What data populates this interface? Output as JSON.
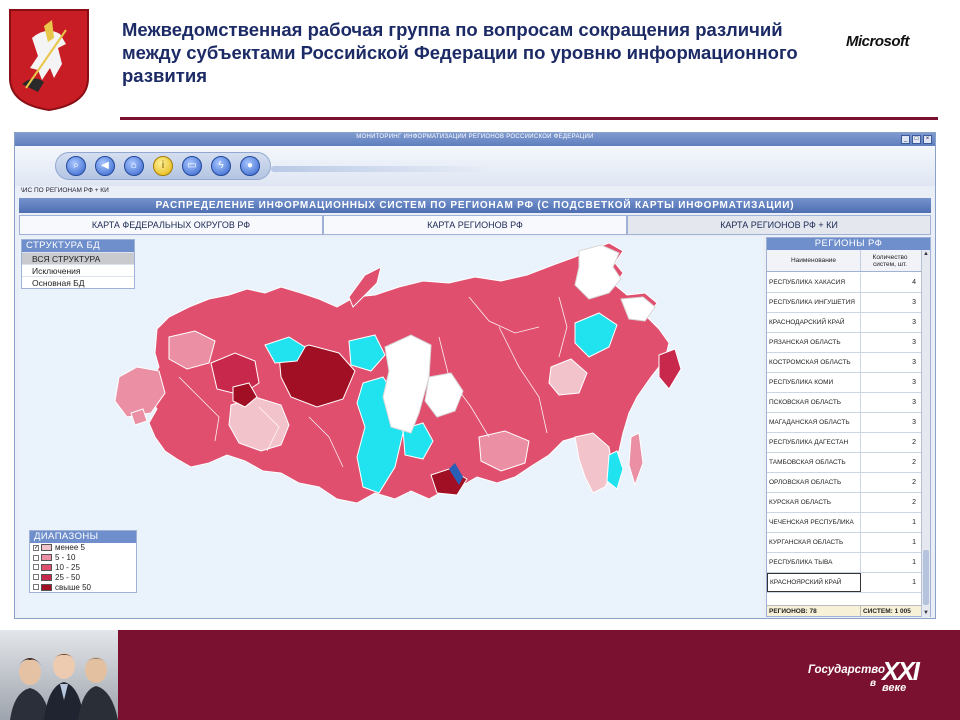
{
  "slide": {
    "title": "Межведомственная рабочая группа по вопросам сокращения различий между субъектами Российской Федерации по уровню информационного развития",
    "logo_text": "Microsoft",
    "footer_logo": {
      "word": "Государство",
      "numeral": "XXI",
      "preposition": "в",
      "suffix": "веке"
    }
  },
  "app": {
    "window_title": "МОНИТОРИНГ ИНФОРМАТИЗАЦИИ РЕГИОНОВ РОССИЙСКОЙ ФЕДЕРАЦИИ",
    "toolbar_icons": [
      "search-icon",
      "back-icon",
      "home-icon",
      "info-icon",
      "book-icon",
      "lightning-icon",
      "user-icon"
    ],
    "breadcrumb": "\\ИС ПО РЕГИОНАМ РФ + КИ",
    "section_title": "РАСПРЕДЕЛЕНИЕ ИНФОРМАЦИОННЫХ СИСТЕМ ПО РЕГИОНАМ РФ (С ПОДСВЕТКОЙ КАРТЫ ИНФОРМАТИЗАЦИИ)",
    "tabs": [
      "КАРТА ФЕДЕРАЛЬНЫХ ОКРУГОВ РФ",
      "КАРТА РЕГИОНОВ РФ",
      "КАРТА РЕГИОНОВ РФ + КИ"
    ],
    "active_tab": 2,
    "structure_panel": {
      "title": "СТРУКТУРА БД",
      "items": [
        "ВСЯ СТРУКТУРА",
        "Исключения",
        "Основная БД"
      ],
      "selected": 0
    },
    "legend_panel": {
      "title": "ДИАПАЗОНЫ",
      "items": [
        {
          "label": "менее 5",
          "color": "#f3c3cc",
          "checked": true
        },
        {
          "label": "5 - 10",
          "color": "#ea8fa4",
          "checked": false
        },
        {
          "label": "10 - 25",
          "color": "#e0506e",
          "checked": false
        },
        {
          "label": "25 - 50",
          "color": "#c8284c",
          "checked": false
        },
        {
          "label": "свыше 50",
          "color": "#a00f24",
          "checked": false
        }
      ]
    },
    "map_colors": {
      "cyan": "#21e3ef",
      "white": "#ffffff",
      "lightpink": "#f3c3cc",
      "pink": "#ea8fa4",
      "red": "#e0506e",
      "crimson": "#c8284c",
      "darkred": "#a00f24",
      "sea": "#eaf2fb"
    },
    "regions_panel": {
      "title": "РЕГИОНЫ РФ",
      "col_name": "Наименование",
      "col_count": "Количество систем, шт.",
      "rows": [
        {
          "name": "РЕСПУБЛИКА ХАКАСИЯ",
          "count": "4"
        },
        {
          "name": "РЕСПУБЛИКА ИНГУШЕТИЯ",
          "count": "3"
        },
        {
          "name": "КРАСНОДАРСКИЙ КРАЙ",
          "count": "3"
        },
        {
          "name": "РЯЗАНСКАЯ ОБЛАСТЬ",
          "count": "3"
        },
        {
          "name": "КОСТРОМСКАЯ ОБЛАСТЬ",
          "count": "3"
        },
        {
          "name": "РЕСПУБЛИКА КОМИ",
          "count": "3"
        },
        {
          "name": "ПСКОВСКАЯ ОБЛАСТЬ",
          "count": "3"
        },
        {
          "name": "МАГАДАНСКАЯ ОБЛАСТЬ",
          "count": "3"
        },
        {
          "name": "РЕСПУБЛИКА ДАГЕСТАН",
          "count": "2"
        },
        {
          "name": "ТАМБОВСКАЯ ОБЛАСТЬ",
          "count": "2"
        },
        {
          "name": "ОРЛОВСКАЯ ОБЛАСТЬ",
          "count": "2"
        },
        {
          "name": "КУРСКАЯ ОБЛАСТЬ",
          "count": "2"
        },
        {
          "name": "ЧЕЧЕНСКАЯ РЕСПУБЛИКА",
          "count": "1"
        },
        {
          "name": "КУРГАНСКАЯ ОБЛАСТЬ",
          "count": "1"
        },
        {
          "name": "РЕСПУБЛИКА ТЫВА",
          "count": "1"
        },
        {
          "name": "КРАСНОЯРСКИЙ КРАЙ",
          "count": "1"
        }
      ],
      "selected_row": 15,
      "footer_regions": "РЕГИОНОВ: 78",
      "footer_systems": "СИСТЕМ: 1 005"
    }
  }
}
